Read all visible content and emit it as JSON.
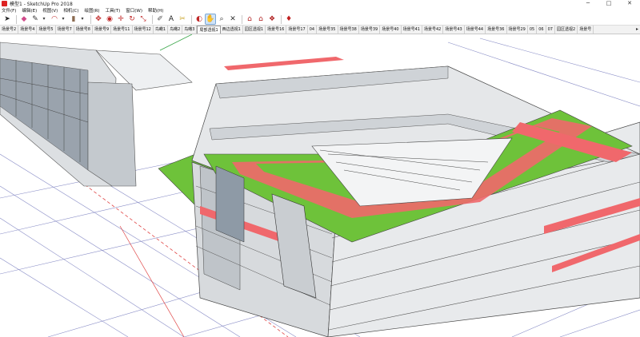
{
  "window": {
    "title": "模型1 - SketchUp Pro 2018",
    "minimize_label": "─",
    "maximize_label": "□",
    "close_label": "✕"
  },
  "menu": {
    "items": [
      "文件(F)",
      "编辑(E)",
      "视图(V)",
      "相机(C)",
      "绘图(R)",
      "工具(T)",
      "窗口(W)",
      "帮助(H)"
    ]
  },
  "toolbar": {
    "tools": [
      {
        "icon": "select-arrow-icon",
        "glyph": "➤"
      },
      {
        "icon": "eraser-icon",
        "glyph": "◆"
      },
      {
        "icon": "pencil-line-icon",
        "glyph": "✎"
      },
      {
        "icon": "arc-icon",
        "glyph": "◠"
      },
      {
        "icon": "push-pull-icon",
        "glyph": "▮"
      },
      {
        "icon": "move-icon",
        "glyph": "✥"
      },
      {
        "icon": "paint-bucket-icon",
        "glyph": "◉"
      },
      {
        "icon": "move-arrows-icon",
        "glyph": "✛"
      },
      {
        "icon": "rotate-icon",
        "glyph": "↻"
      },
      {
        "icon": "scale-icon",
        "glyph": "⤡"
      },
      {
        "icon": "tape-measure-icon",
        "glyph": "✐"
      },
      {
        "icon": "text-icon",
        "glyph": "A"
      },
      {
        "icon": "section-icon",
        "glyph": "✂"
      },
      {
        "icon": "orbit-icon",
        "glyph": "◐"
      },
      {
        "icon": "pan-icon",
        "glyph": "✋"
      },
      {
        "icon": "zoom-icon",
        "glyph": "⌕"
      },
      {
        "icon": "zoom-extents-icon",
        "glyph": "✕"
      },
      {
        "icon": "warehouse-icon",
        "glyph": "⌂"
      },
      {
        "icon": "extension-warehouse-icon",
        "glyph": "⌂"
      },
      {
        "icon": "components-icon",
        "glyph": "❖"
      },
      {
        "icon": "ruby-icon",
        "glyph": "♦"
      }
    ]
  },
  "scenes": {
    "tabs": [
      "场景号2",
      "场景号4",
      "场景号5",
      "场景号7",
      "场景号8",
      "场景号9",
      "场景号11",
      "场景号12",
      "鸟瞰1",
      "鸟瞰2",
      "鸟瞰3",
      "局部透视1",
      "西边透视1",
      "园区透视1",
      "场景号16",
      "场景号17",
      "04",
      "场景号35",
      "场景号38",
      "场景号39",
      "场景号40",
      "场景号41",
      "场景号42",
      "场景号43",
      "场景号44",
      "场景号36",
      "场景号29",
      "05",
      "06",
      "07",
      "园区透视2",
      "场景号"
    ],
    "active_index": 11,
    "more_glyph": "▸"
  },
  "colors": {
    "roof_green": "#6ec23a",
    "roof_red": "#f0686c",
    "wall": "#e8e8e8",
    "wall_shade": "#b9bcbf",
    "glass": "#8e9aa6",
    "grid_line": "#5a5fb0",
    "axis_red": "#e04545",
    "axis_green": "#3aa64a"
  }
}
